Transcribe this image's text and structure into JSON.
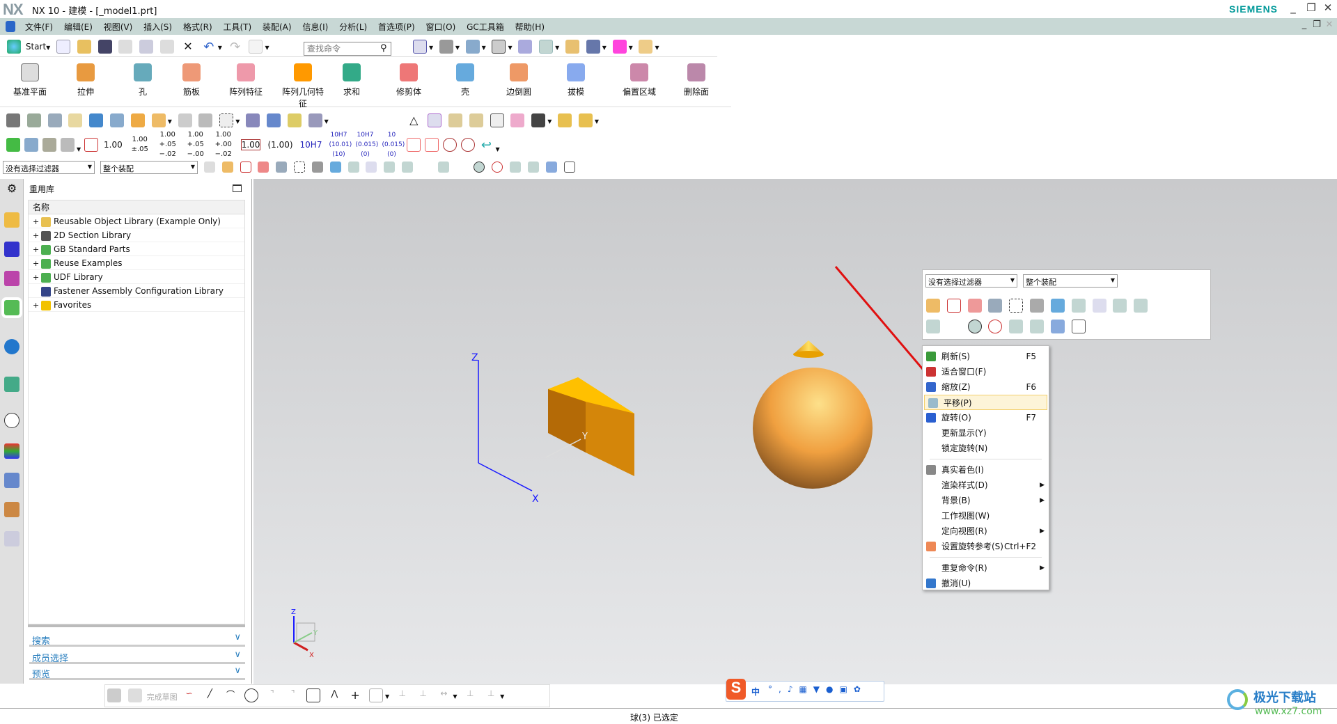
{
  "titlebar": {
    "logo": "NX",
    "title": "NX 10 - 建模 - [_model1.prt]",
    "brand": "SIEMENS",
    "brand_color": "#009999"
  },
  "menubar": {
    "items": [
      "文件(F)",
      "编辑(E)",
      "视图(V)",
      "插入(S)",
      "格式(R)",
      "工具(T)",
      "装配(A)",
      "信息(I)",
      "分析(L)",
      "首选项(P)",
      "窗口(O)",
      "GC工具箱",
      "帮助(H)"
    ]
  },
  "toolbar": {
    "start_label": "Start",
    "search_placeholder": "查找命令"
  },
  "ribbon": {
    "items": [
      "基准平面",
      "拉伸",
      "孔",
      "筋板",
      "阵列特征",
      "阵列几何特征",
      "求和",
      "修剪体",
      "壳",
      "边倒圆",
      "拔模",
      "偏置区域",
      "删除面"
    ]
  },
  "dimension_toolbar": {
    "labels": [
      "1.00",
      "1.00 ±.05",
      "1.00 +.05 −.02",
      "1.00 +.05 −.00",
      "1.00 +.00 −.02",
      "1.00",
      "(1.00)",
      "10H7",
      "10H7 (10.01) (10)",
      "10H7 (0.015) (0)",
      "10 (0.015) (0)"
    ]
  },
  "selection": {
    "filter": "没有选择过滤器",
    "scope": "整个装配"
  },
  "panel": {
    "title": "重用库",
    "column": "名称",
    "tree": [
      {
        "label": "Reusable Object Library (Example Only)",
        "expandable": true,
        "icon_color": "#e8c050"
      },
      {
        "label": "2D Section Library",
        "expandable": true,
        "icon_color": "#555555"
      },
      {
        "label": "GB Standard Parts",
        "expandable": true,
        "icon_color": "#4caf50"
      },
      {
        "label": "Reuse Examples",
        "expandable": true,
        "icon_color": "#4caf50"
      },
      {
        "label": "UDF Library",
        "expandable": true,
        "icon_color": "#4caf50"
      },
      {
        "label": "Fastener Assembly Configuration Library",
        "expandable": false,
        "icon_color": "#334488"
      },
      {
        "label": "Favorites",
        "expandable": true,
        "icon_color": "#f2c200"
      }
    ],
    "sections": [
      "搜索",
      "成员选择",
      "预览"
    ]
  },
  "viewport": {
    "axes": {
      "z": "Z",
      "y": "Y",
      "x": "X"
    },
    "triad": {
      "z": "Z",
      "y": "Y",
      "x": "X"
    },
    "box_color": "#d4860a",
    "sphere_color": "#f0a040"
  },
  "context_menu": {
    "items": [
      {
        "label": "刷新(S)",
        "shortcut": "F5",
        "icon": "refresh-icon"
      },
      {
        "label": "适合窗口(F)",
        "shortcut": "",
        "icon": "fit-window-icon"
      },
      {
        "label": "缩放(Z)",
        "shortcut": "F6",
        "icon": "zoom-icon"
      },
      {
        "label": "平移(P)",
        "shortcut": "",
        "icon": "pan-icon",
        "highlighted": true
      },
      {
        "label": "旋转(O)",
        "shortcut": "F7",
        "icon": "rotate-icon"
      },
      {
        "label": "更新显示(Y)",
        "shortcut": ""
      },
      {
        "label": "锁定旋转(N)",
        "shortcut": ""
      },
      {
        "separator": true
      },
      {
        "label": "真实着色(I)",
        "shortcut": "",
        "icon": "true-shading-icon"
      },
      {
        "label": "渲染样式(D)",
        "submenu": true
      },
      {
        "label": "背景(B)",
        "submenu": true
      },
      {
        "label": "工作视图(W)"
      },
      {
        "label": "定向视图(R)",
        "submenu": true
      },
      {
        "label": "设置旋转参考(S)",
        "shortcut": "Ctrl+F2",
        "icon": "rotate-reference-icon"
      },
      {
        "separator": true
      },
      {
        "label": "重复命令(R)",
        "submenu": true
      },
      {
        "label": "撤消(U)",
        "icon": "undo-icon"
      }
    ]
  },
  "sketch_toolbar": {
    "finish_label": "完成草图"
  },
  "status": {
    "text": "球(3) 已选定"
  },
  "ime": {
    "lang": "中"
  },
  "watermark": {
    "text": "极光下载站",
    "url": "www.xz7.com"
  }
}
